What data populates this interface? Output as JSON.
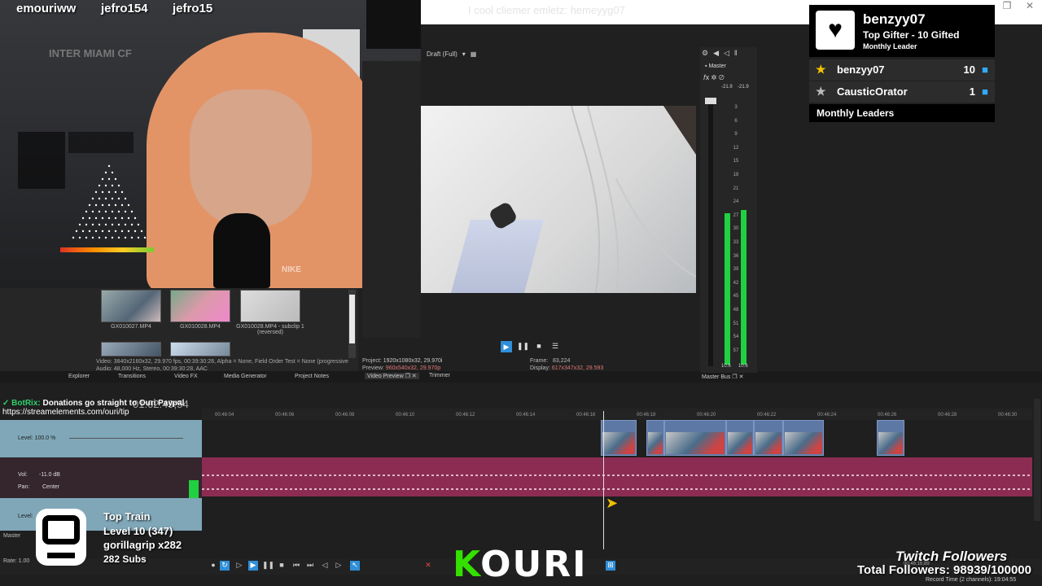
{
  "overlay_top": {
    "ghost_text": "I cool cliemer emletz: hemeyyg07"
  },
  "webcam": {
    "viewers": [
      "emouriww",
      "jefro154",
      "jefro15"
    ],
    "shirt_text": "NIKE",
    "poster_text": "INTER MIAMI CF"
  },
  "media_bin": {
    "items": [
      {
        "name": "GX010027.MP4"
      },
      {
        "name": "GX010028.MP4"
      },
      {
        "name": "GX010028.MP4 - subclip 1 (reversed)"
      }
    ],
    "meta_line1": "Video: 3840x2160x32, 29.970 fps, 00:39:30:28, Alpha = None, Field Order Test = None (progressive",
    "meta_line2": "Audio: 48,000 Hz, Stereo, 00:39:30:28, AAC"
  },
  "tabs": [
    "Explorer",
    "Transitions",
    "Video FX",
    "Media Generator",
    "Project Notes"
  ],
  "preview": {
    "quality": "Draft (Full)",
    "project_label": "Project:",
    "project_value": "1920x1080x32, 29.970i",
    "preview_label": "Preview:",
    "preview_value": "960x540x32, 29.970p",
    "frame_label": "Frame:",
    "frame_value": "83,224",
    "display_label": "Display:",
    "display_value": "617x347x32, 29.593",
    "tabs": [
      "Video Preview",
      "Trimmer"
    ]
  },
  "master_bus": {
    "label": "Master",
    "left_peak": "-21.9",
    "right_peak": "-21.9",
    "scale": [
      "3",
      "6",
      "9",
      "12",
      "15",
      "18",
      "21",
      "24",
      "27",
      "30",
      "33",
      "36",
      "39",
      "42",
      "45",
      "48",
      "51",
      "54",
      "57"
    ],
    "bottom_left": "10.6",
    "bottom_right": "10.6",
    "tab": "Master Bus",
    "level_left": 0.52,
    "level_right": 0.54
  },
  "gifter": {
    "name": "benzyy07",
    "title": "Top Gifter - 10 Gifted",
    "subtitle": "Monthly Leader",
    "rows": [
      {
        "name": "benzyy07",
        "count": "10"
      },
      {
        "name": "CausticOrator",
        "count": "1"
      }
    ],
    "footer": "Monthly Leaders"
  },
  "chat": {
    "bot_name": "BotRix:",
    "message": "Donations go straight to Ouri Paypal",
    "link": "https://streamelements.com/ouri/tip"
  },
  "timeline": {
    "timecode": "01:02:49;54",
    "ruler": [
      "00:46:04",
      "00:46:06",
      "00:46:08",
      "00:46:10",
      "00:46:12",
      "00:46:14",
      "00:46:16",
      "00:46:18",
      "00:46:20",
      "00:46:22",
      "00:46:24",
      "00:46:26",
      "00:46:28",
      "00:46:30"
    ],
    "track1_level": "Level: 100.0 %",
    "track2_vol": "Vol:",
    "track2_vol_value": "-11.0 dB",
    "track2_pan": "Pan:",
    "track2_pan_value": "Center",
    "track3_level": "Level:",
    "master_label": "Master",
    "rate_label": "Rate: 1.00",
    "record_time": "Record Time (2 channels): 19:04:55",
    "end_time": "00:46:16;89"
  },
  "train": {
    "title": "Top Train",
    "level": "Level 10 (347)",
    "leader": "gorillagrip x282",
    "subs": "282 Subs"
  },
  "brand": {
    "k": "K",
    "rest": "OURI"
  },
  "followers": {
    "title": "Twitch Followers",
    "total": "Total Followers: 98939/100000"
  },
  "colors": {
    "accent_blue": "#2f8fd8",
    "meter_green": "#20d040",
    "audio_track": "#8c2c52",
    "kouri_green": "#33e000"
  }
}
